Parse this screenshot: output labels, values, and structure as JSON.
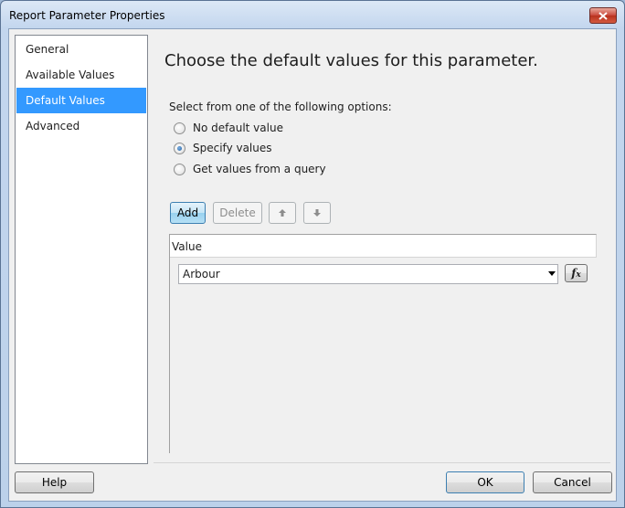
{
  "window": {
    "title": "Report Parameter Properties"
  },
  "nav": {
    "items": [
      {
        "label": "General",
        "selected": false
      },
      {
        "label": "Available Values",
        "selected": false
      },
      {
        "label": "Default Values",
        "selected": true
      },
      {
        "label": "Advanced",
        "selected": false
      }
    ]
  },
  "main": {
    "heading": "Choose the default values for this parameter.",
    "options_label": "Select from one of the following options:",
    "options": [
      {
        "label": "No default value",
        "checked": false
      },
      {
        "label": "Specify values",
        "checked": true
      },
      {
        "label": "Get values from a query",
        "checked": false
      }
    ],
    "toolbar": {
      "add_label": "Add",
      "delete_label": "Delete",
      "move_up_icon": "arrow-up-icon",
      "move_down_icon": "arrow-down-icon"
    },
    "grid": {
      "column_header": "Value",
      "rows": [
        {
          "value": "Arbour",
          "expression_button": "fx"
        }
      ]
    }
  },
  "footer": {
    "help_label": "Help",
    "ok_label": "OK",
    "cancel_label": "Cancel"
  },
  "colors": {
    "selection": "#3399ff",
    "close_button": "#c9473a",
    "title_bar": "#c3d6ee"
  }
}
